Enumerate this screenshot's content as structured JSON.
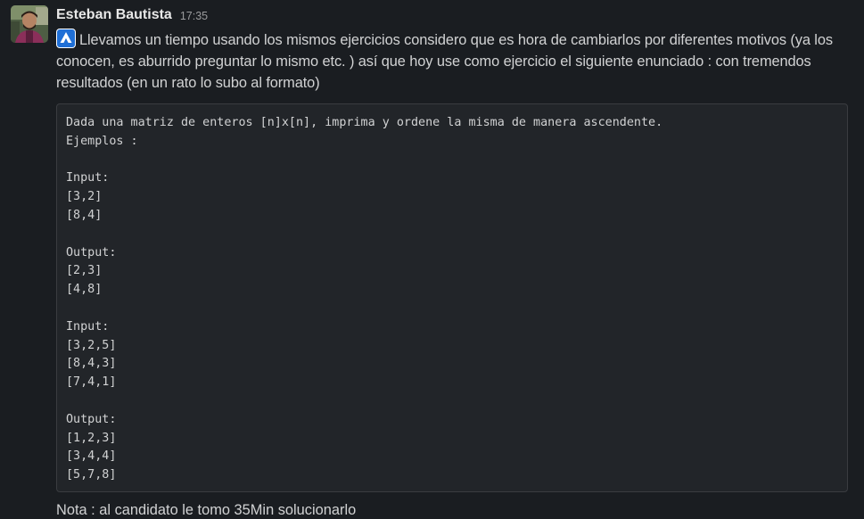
{
  "message": {
    "author": "Esteban Bautista",
    "timestamp": "17:35",
    "avatar_icon": "user-avatar-photo",
    "emoji_icon": "blue-logo-emoji",
    "body_text": "Llevamos un tiempo usando los mismos ejercicios considero que es hora de cambiarlos por diferentes motivos (ya los conocen, es aburrido preguntar lo mismo etc. ) así que hoy use como ejercicio el siguiente enunciado : con tremendos resultados (en un rato lo subo al formato)",
    "code_lines": [
      "Dada una matriz de enteros [n]x[n], imprima y ordene la misma de manera ascendente.",
      "Ejemplos :",
      "",
      "Input:",
      "[3,2]",
      "[8,4]",
      "",
      "Output:",
      "[2,3]",
      "[4,8]",
      "",
      "Input:",
      "[3,2,5]",
      "[8,4,3]",
      "[7,4,1]",
      "",
      "Output:",
      "[1,2,3]",
      "[3,4,4]",
      "[5,7,8]"
    ],
    "footnote": "Nota : al candidato le tomo 35Min solucionarlo"
  },
  "colors": {
    "background": "#1a1d21",
    "code_background": "#222529",
    "text": "#d1d2d3",
    "emoji_blue": "#1f6fd6"
  }
}
